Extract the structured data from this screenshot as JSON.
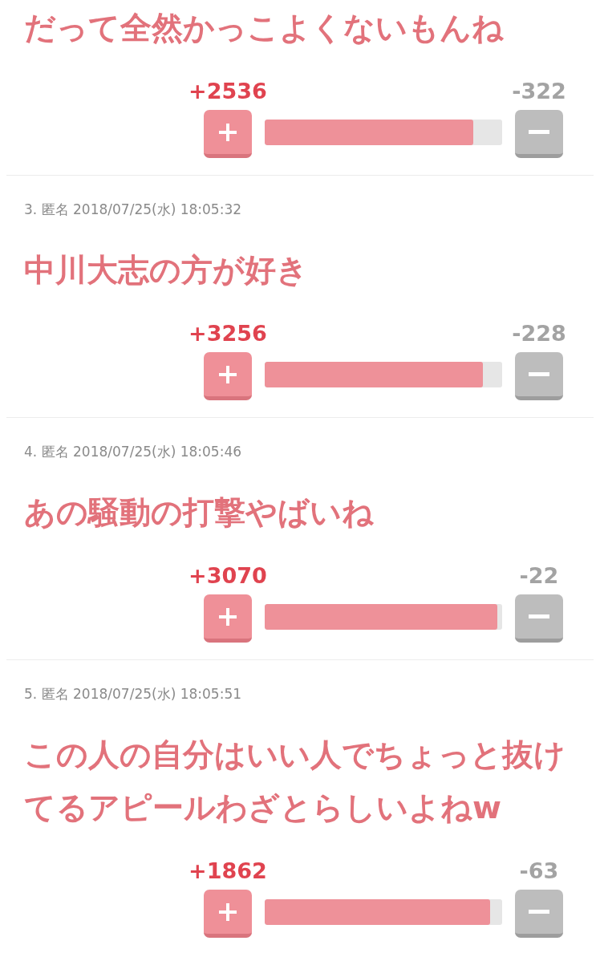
{
  "comments": [
    {
      "title": "だって全然かっこよくないもんね",
      "plus_count": "+2536",
      "minus_count": "-322",
      "level": 0.88
    },
    {
      "header": "3. 匿名 2018/07/25(水) 18:05:32",
      "title": "中川大志の方が好き",
      "plus_count": "+3256",
      "minus_count": "-228",
      "level": 0.92
    },
    {
      "header": "4. 匿名 2018/07/25(水) 18:05:46",
      "title": "あの騒動の打撃やばいね",
      "plus_count": "+3070",
      "minus_count": "-22",
      "level": 0.98
    },
    {
      "header": "5. 匿名 2018/07/25(水) 18:05:51",
      "title": "この人の自分はいい人でちょっと抜けてるアピールわざとらしいよねw",
      "plus_count": "+1862",
      "minus_count": "-63",
      "level": 0.95
    }
  ]
}
